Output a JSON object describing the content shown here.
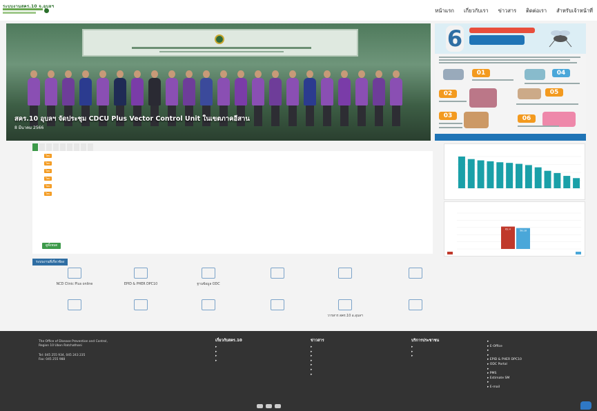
{
  "header": {
    "logo_text": "ระบบงานสคร.10 จ.อุบลฯ",
    "nav": [
      "หน้าแรก",
      "เกี่ยวกับเรา",
      "ข่าวสาร",
      "ติดต่อเรา",
      "สำหรับเจ้าหน้าที่"
    ]
  },
  "hero": {
    "caption": "สคร.10 อุบลฯ จัดประชุม CDCU Plus Vector Control Unit ในเขตภาคอีสาน",
    "date": "8 มีนาคม 2566"
  },
  "poster": {
    "number": "6",
    "steps": [
      "01",
      "02",
      "03",
      "04",
      "05",
      "06"
    ]
  },
  "news_tabs": [
    "",
    "",
    "",
    "",
    "",
    "",
    "",
    "",
    ""
  ],
  "news": [
    {
      "date": "",
      "badge": "ใหม่",
      "text": ""
    },
    {
      "date": "",
      "badge": "ใหม่",
      "text": ""
    },
    {
      "date": "",
      "badge": "ใหม่",
      "text": ""
    },
    {
      "date": "",
      "badge": "ใหม่",
      "text": ""
    },
    {
      "date": "",
      "badge": "ใหม่",
      "text": ""
    },
    {
      "date": "",
      "badge": "ใหม่",
      "text": ""
    }
  ],
  "more_label": "ดูทั้งหมด",
  "chart_data": [
    {
      "type": "bar",
      "title": "",
      "categories": [
        "",
        "",
        "",
        "",
        "",
        "",
        "",
        "",
        "",
        "",
        "",
        "",
        ""
      ],
      "values": [
        10,
        9.2,
        8.8,
        8.5,
        8.2,
        8.0,
        7.7,
        7.3,
        6.6,
        5.5,
        4.8,
        3.9,
        3.2
      ],
      "color": "#1aa0a8"
    },
    {
      "type": "bar",
      "title": "",
      "categories": [
        "",
        ""
      ],
      "series": [
        {
          "name": "",
          "values": [
            62.4
          ],
          "color": "#c0392b"
        },
        {
          "name": "",
          "values": [
            58.18
          ],
          "color": "#4aa7d9"
        }
      ],
      "ylim": [
        0,
        100
      ]
    }
  ],
  "services": {
    "header": "ระบบงานที่เกี่ยวข้อง",
    "items": [
      {
        "label": "NCD Clinic Plus online",
        "icon": "edit-icon"
      },
      {
        "label": "EPID & PHER DPC10",
        "icon": "trend-icon"
      },
      {
        "label": "ฐานข้อมูล ODC",
        "icon": "database-icon"
      },
      {
        "label": "",
        "icon": "clock-icon"
      },
      {
        "label": "",
        "icon": "people-icon"
      },
      {
        "label": "",
        "icon": "document-icon"
      },
      {
        "label": "",
        "icon": "monitor-icon"
      },
      {
        "label": "",
        "icon": "piechart-icon"
      },
      {
        "label": "",
        "icon": "window-icon"
      },
      {
        "label": "",
        "icon": "download-icon"
      },
      {
        "label": "วารสาร สคร.10 อ.อุบลฯ",
        "icon": "book-icon"
      },
      {
        "label": "",
        "icon": "chat-icon"
      }
    ]
  },
  "footer": {
    "org_name": "",
    "org_en1": "The Office of Disease Prevention and Control,",
    "org_en2": "Region 10 Ubon Ratchathani",
    "phone": "Tel: 045 255 934, 045 243 235",
    "fax": "Fax: 045 255 988",
    "col2_title": "เกี่ยวกับสคร.10",
    "col2_links": [
      "",
      "",
      "",
      ""
    ],
    "col3_title": "ข่าวสาร",
    "col3_links": [
      "",
      "",
      "",
      "",
      "",
      "",
      ""
    ],
    "col4_title": "บริการประชาชน",
    "col4_links": [
      "",
      "",
      ""
    ],
    "col5_title": "",
    "col5_links": [
      "",
      "E-Office",
      "",
      "",
      "EPID & PHER DPC10",
      "ODC Portal",
      "",
      "PMS",
      "Estimate SM",
      "",
      "E-mail"
    ]
  }
}
